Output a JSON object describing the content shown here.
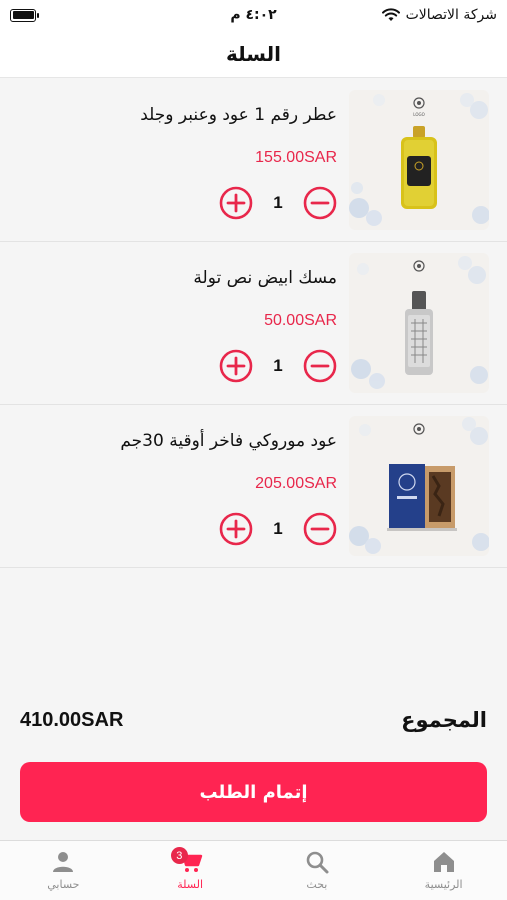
{
  "status": {
    "carrier": "شركة الاتصالات",
    "time": "٤:٠٢ م"
  },
  "header": {
    "title": "السلة"
  },
  "items": [
    {
      "title": "عطر رقم 1 عود وعنبر وجلد",
      "price": "155.00SAR",
      "qty": "1",
      "image": "perfume-bottle-image"
    },
    {
      "title": "مسك ابيض نص تولة",
      "price": "50.00SAR",
      "qty": "1",
      "image": "musk-vial-image"
    },
    {
      "title": "عود موروكي فاخر أوقية 30جم",
      "price": "205.00SAR",
      "qty": "1",
      "image": "oud-box-image"
    }
  ],
  "summary": {
    "label": "المجموع",
    "amount": "410.00SAR"
  },
  "checkout": {
    "label": "إتمام الطلب"
  },
  "tabs": [
    {
      "label": "الرئيسية",
      "icon": "home-icon"
    },
    {
      "label": "بحث",
      "icon": "search-icon"
    },
    {
      "label": "السلة",
      "icon": "cart-icon",
      "badge": "3"
    },
    {
      "label": "حسابي",
      "icon": "person-icon"
    }
  ],
  "colors": {
    "accent": "#ff2452",
    "price": "#e8274b"
  }
}
